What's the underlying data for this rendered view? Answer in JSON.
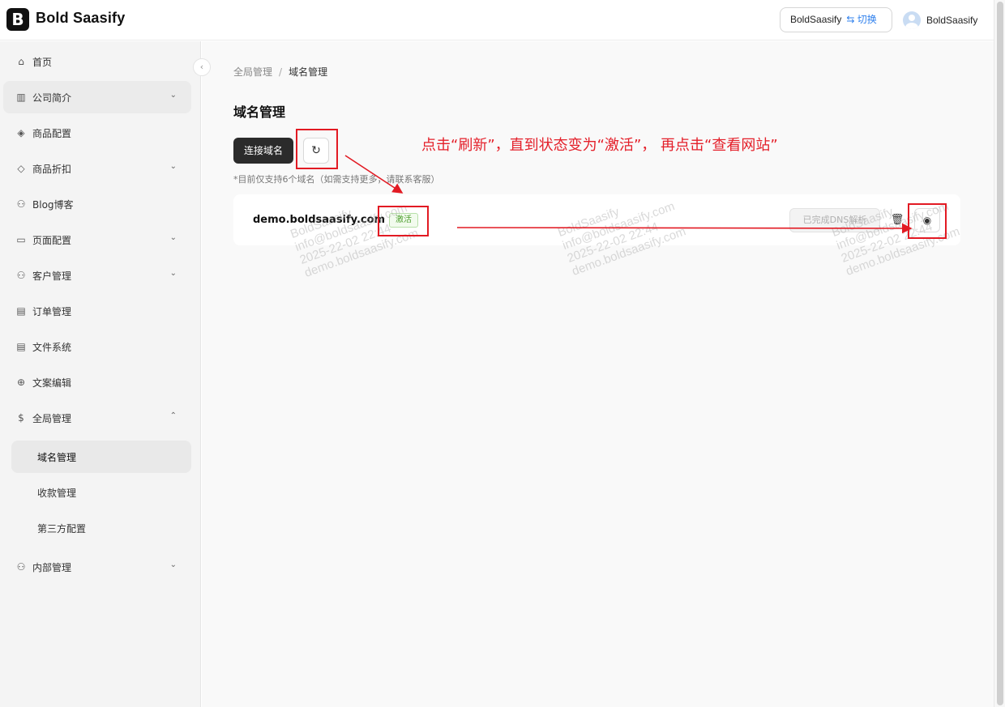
{
  "app": {
    "logo_letter": "B",
    "title": "Bold Saasify"
  },
  "header": {
    "store_name": "BoldSaasify",
    "switch_label": "⇆ 切换",
    "user_name": "BoldSaasify"
  },
  "sidebar": {
    "items": [
      {
        "label": "首页",
        "icon": "home-icon"
      },
      {
        "label": "公司简介",
        "icon": "building-icon"
      },
      {
        "label": "商品配置",
        "icon": "box-icon"
      },
      {
        "label": "商品折扣",
        "icon": "tag-icon"
      },
      {
        "label": "Blog博客",
        "icon": "users-icon"
      },
      {
        "label": "页面配置",
        "icon": "monitor-icon"
      },
      {
        "label": "客户管理",
        "icon": "users-icon"
      },
      {
        "label": "订单管理",
        "icon": "document-icon"
      },
      {
        "label": "文件系统",
        "icon": "file-icon"
      },
      {
        "label": "文案编辑",
        "icon": "globe-icon"
      },
      {
        "label": "全局管理",
        "icon": "dollar-icon"
      },
      {
        "label": "内部管理",
        "icon": "person-icon"
      }
    ],
    "sub_items": [
      {
        "label": "域名管理"
      },
      {
        "label": "收款管理"
      },
      {
        "label": "第三方配置"
      }
    ]
  },
  "breadcrumb": {
    "parent": "全局管理",
    "separator": "/",
    "current": "域名管理"
  },
  "page": {
    "title": "域名管理",
    "connect_button": "连接域名",
    "hint": "*目前仅支持6个域名（如需支持更多，请联系客服）"
  },
  "domain": {
    "name": "demo.boldsaasify.com",
    "status": "激活",
    "dns_button": "已完成DNS解析"
  },
  "annotation": {
    "instruction": "点击“刷新”，直到状态变为“激活”， 再点击“查看网站”",
    "color": "#e21a23"
  },
  "watermark": {
    "lines": [
      "BoldSaasify",
      "info@boldsaasify.com",
      "2025-22-02 22:44",
      "demo.boldsaasify.com"
    ]
  }
}
